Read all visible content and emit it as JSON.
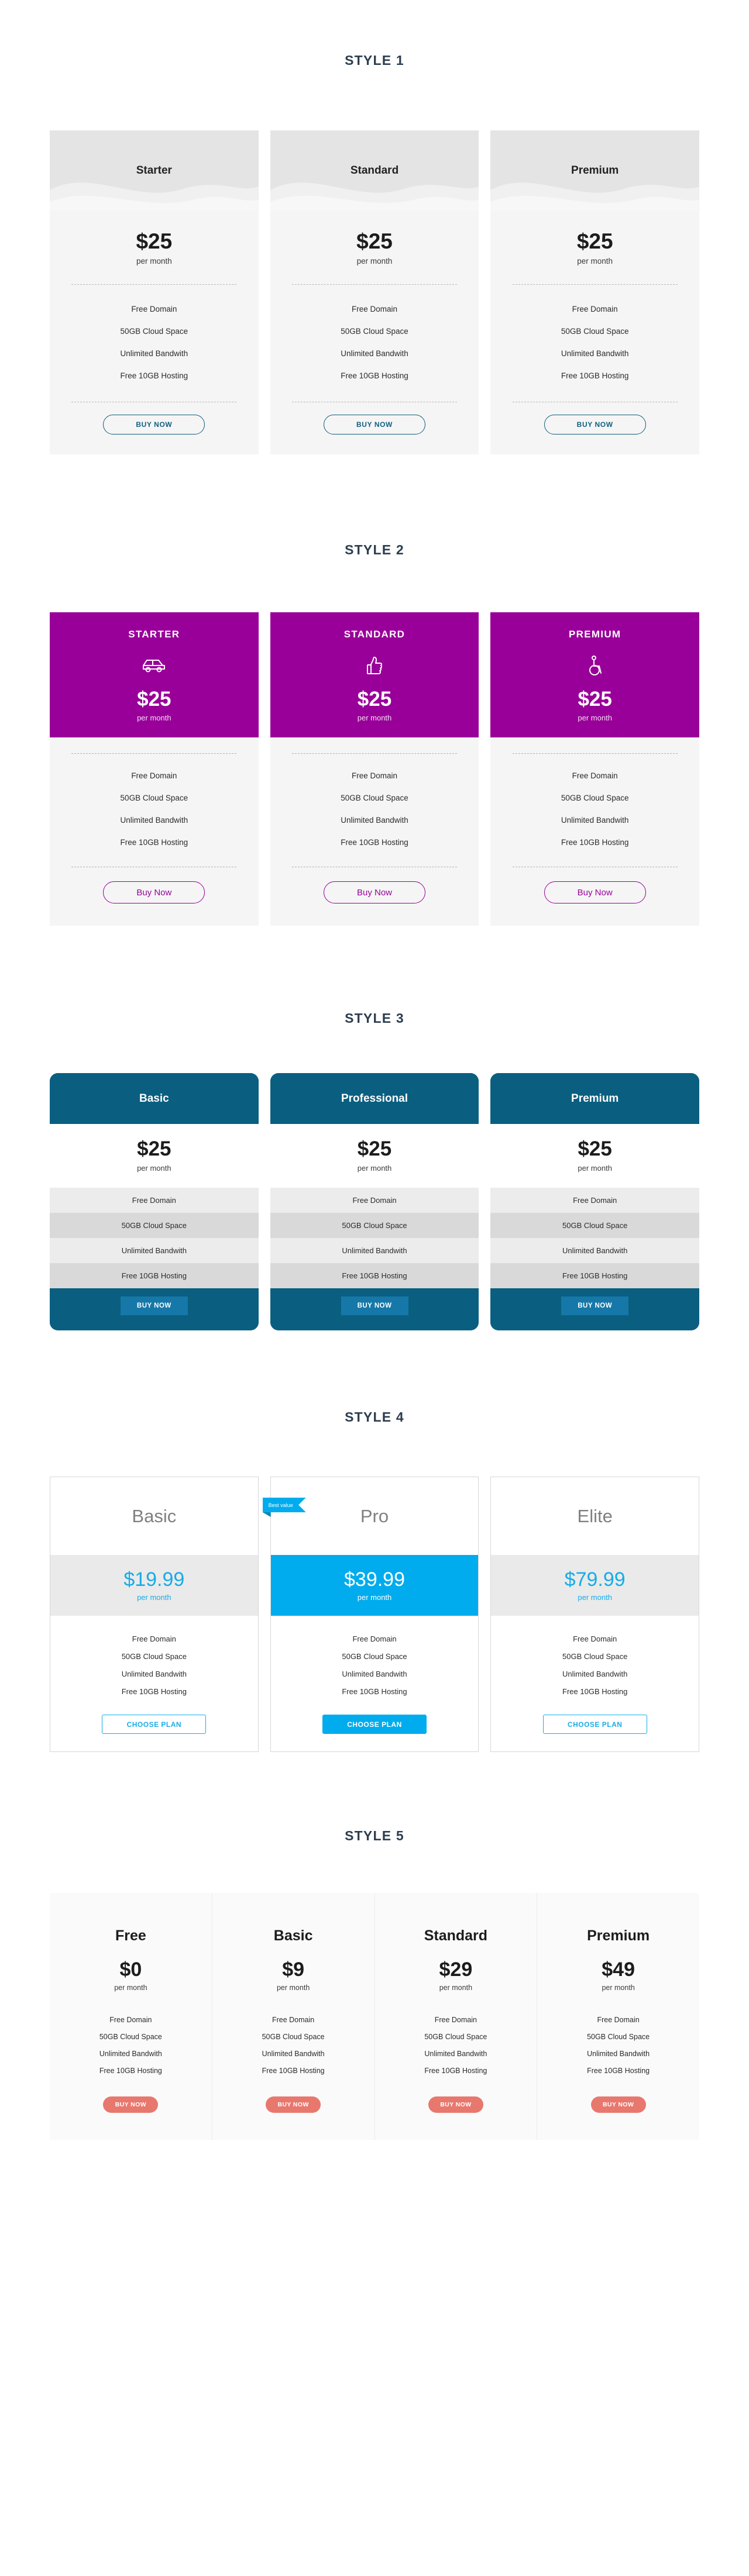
{
  "shared": {
    "features": [
      "Free Domain",
      "50GB Cloud Space",
      "Unlimited Bandwith",
      "Free 10GB Hosting"
    ],
    "per_month": "per month"
  },
  "colors": {
    "section_title": "#2c3e50",
    "style1_header_bg": "#e4e4e4",
    "style1_accent": "#0e5e7e",
    "style2_accent": "#990099",
    "style3_accent": "#0a5f80",
    "style3_button": "#1678a8",
    "style4_accent": "#17ace8",
    "style4_featured": "#00aced",
    "style5_button": "#e8786e"
  },
  "style1": {
    "title": "STYLE 1",
    "cards": [
      {
        "plan": "Starter",
        "price": "$25",
        "per": "per month",
        "features": [
          "Free Domain",
          "50GB Cloud Space",
          "Unlimited Bandwith",
          "Free 10GB Hosting"
        ],
        "cta": "BUY NOW"
      },
      {
        "plan": "Standard",
        "price": "$25",
        "per": "per month",
        "features": [
          "Free Domain",
          "50GB Cloud Space",
          "Unlimited Bandwith",
          "Free 10GB Hosting"
        ],
        "cta": "BUY NOW"
      },
      {
        "plan": "Premium",
        "price": "$25",
        "per": "per month",
        "features": [
          "Free Domain",
          "50GB Cloud Space",
          "Unlimited Bandwith",
          "Free 10GB Hosting"
        ],
        "cta": "BUY NOW"
      }
    ]
  },
  "style2": {
    "title": "STYLE 2",
    "cards": [
      {
        "plan": "STARTER",
        "icon": "car-icon",
        "price": "$25",
        "per": "per month",
        "features": [
          "Free Domain",
          "50GB Cloud Space",
          "Unlimited Bandwith",
          "Free 10GB Hosting"
        ],
        "cta": "Buy Now"
      },
      {
        "plan": "STANDARD",
        "icon": "thumbs-up-icon",
        "price": "$25",
        "per": "per month",
        "features": [
          "Free Domain",
          "50GB Cloud Space",
          "Unlimited Bandwith",
          "Free 10GB Hosting"
        ],
        "cta": "Buy Now"
      },
      {
        "plan": "PREMIUM",
        "icon": "wheelchair-icon",
        "price": "$25",
        "per": "per month",
        "features": [
          "Free Domain",
          "50GB Cloud Space",
          "Unlimited Bandwith",
          "Free 10GB Hosting"
        ],
        "cta": "Buy Now"
      }
    ]
  },
  "style3": {
    "title": "STYLE 3",
    "cards": [
      {
        "plan": "Basic",
        "price": "$25",
        "per": "per month",
        "features": [
          "Free Domain",
          "50GB Cloud Space",
          "Unlimited Bandwith",
          "Free 10GB Hosting"
        ],
        "cta": "BUY NOW"
      },
      {
        "plan": "Professional",
        "price": "$25",
        "per": "per month",
        "features": [
          "Free Domain",
          "50GB Cloud Space",
          "Unlimited Bandwith",
          "Free 10GB Hosting"
        ],
        "cta": "BUY NOW"
      },
      {
        "plan": "Premium",
        "price": "$25",
        "per": "per month",
        "features": [
          "Free Domain",
          "50GB Cloud Space",
          "Unlimited Bandwith",
          "Free 10GB Hosting"
        ],
        "cta": "BUY NOW"
      }
    ]
  },
  "style4": {
    "title": "STYLE 4",
    "ribbon": "Best value",
    "cards": [
      {
        "plan": "Basic",
        "price": "$19.99",
        "per": "per month",
        "featured": false,
        "features": [
          "Free Domain",
          "50GB Cloud Space",
          "Unlimited Bandwith",
          "Free 10GB Hosting"
        ],
        "cta": "CHOOSE PLAN"
      },
      {
        "plan": "Pro",
        "price": "$39.99",
        "per": "per month",
        "featured": true,
        "features": [
          "Free Domain",
          "50GB Cloud Space",
          "Unlimited Bandwith",
          "Free 10GB Hosting"
        ],
        "cta": "CHOOSE PLAN"
      },
      {
        "plan": "Elite",
        "price": "$79.99",
        "per": "per month",
        "featured": false,
        "features": [
          "Free Domain",
          "50GB Cloud Space",
          "Unlimited Bandwith",
          "Free 10GB Hosting"
        ],
        "cta": "CHOOSE PLAN"
      }
    ]
  },
  "style5": {
    "title": "STYLE 5",
    "cards": [
      {
        "plan": "Free",
        "price": "$0",
        "per": "per month",
        "features": [
          "Free Domain",
          "50GB Cloud Space",
          "Unlimited Bandwith",
          "Free 10GB Hosting"
        ],
        "cta": "BUY NOW"
      },
      {
        "plan": "Basic",
        "price": "$9",
        "per": "per month",
        "features": [
          "Free Domain",
          "50GB Cloud Space",
          "Unlimited Bandwith",
          "Free 10GB Hosting"
        ],
        "cta": "BUY NOW"
      },
      {
        "plan": "Standard",
        "price": "$29",
        "per": "per month",
        "features": [
          "Free Domain",
          "50GB Cloud Space",
          "Unlimited Bandwith",
          "Free 10GB Hosting"
        ],
        "cta": "BUY NOW"
      },
      {
        "plan": "Premium",
        "price": "$49",
        "per": "per month",
        "features": [
          "Free Domain",
          "50GB Cloud Space",
          "Unlimited Bandwith",
          "Free 10GB Hosting"
        ],
        "cta": "BUY NOW"
      }
    ]
  }
}
